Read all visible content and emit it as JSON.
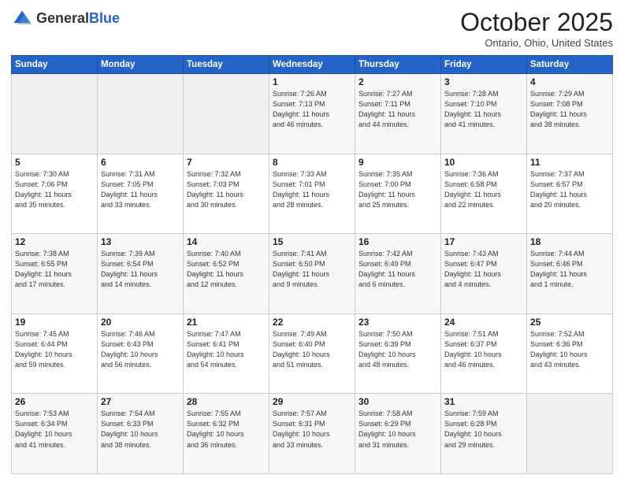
{
  "header": {
    "logo_general": "General",
    "logo_blue": "Blue",
    "month_title": "October 2025",
    "location": "Ontario, Ohio, United States"
  },
  "weekdays": [
    "Sunday",
    "Monday",
    "Tuesday",
    "Wednesday",
    "Thursday",
    "Friday",
    "Saturday"
  ],
  "weeks": [
    [
      {
        "day": "",
        "info": ""
      },
      {
        "day": "",
        "info": ""
      },
      {
        "day": "",
        "info": ""
      },
      {
        "day": "1",
        "info": "Sunrise: 7:26 AM\nSunset: 7:13 PM\nDaylight: 11 hours\nand 46 minutes."
      },
      {
        "day": "2",
        "info": "Sunrise: 7:27 AM\nSunset: 7:11 PM\nDaylight: 11 hours\nand 44 minutes."
      },
      {
        "day": "3",
        "info": "Sunrise: 7:28 AM\nSunset: 7:10 PM\nDaylight: 11 hours\nand 41 minutes."
      },
      {
        "day": "4",
        "info": "Sunrise: 7:29 AM\nSunset: 7:08 PM\nDaylight: 11 hours\nand 38 minutes."
      }
    ],
    [
      {
        "day": "5",
        "info": "Sunrise: 7:30 AM\nSunset: 7:06 PM\nDaylight: 11 hours\nand 35 minutes."
      },
      {
        "day": "6",
        "info": "Sunrise: 7:31 AM\nSunset: 7:05 PM\nDaylight: 11 hours\nand 33 minutes."
      },
      {
        "day": "7",
        "info": "Sunrise: 7:32 AM\nSunset: 7:03 PM\nDaylight: 11 hours\nand 30 minutes."
      },
      {
        "day": "8",
        "info": "Sunrise: 7:33 AM\nSunset: 7:01 PM\nDaylight: 11 hours\nand 28 minutes."
      },
      {
        "day": "9",
        "info": "Sunrise: 7:35 AM\nSunset: 7:00 PM\nDaylight: 11 hours\nand 25 minutes."
      },
      {
        "day": "10",
        "info": "Sunrise: 7:36 AM\nSunset: 6:58 PM\nDaylight: 11 hours\nand 22 minutes."
      },
      {
        "day": "11",
        "info": "Sunrise: 7:37 AM\nSunset: 6:57 PM\nDaylight: 11 hours\nand 20 minutes."
      }
    ],
    [
      {
        "day": "12",
        "info": "Sunrise: 7:38 AM\nSunset: 6:55 PM\nDaylight: 11 hours\nand 17 minutes."
      },
      {
        "day": "13",
        "info": "Sunrise: 7:39 AM\nSunset: 6:54 PM\nDaylight: 11 hours\nand 14 minutes."
      },
      {
        "day": "14",
        "info": "Sunrise: 7:40 AM\nSunset: 6:52 PM\nDaylight: 11 hours\nand 12 minutes."
      },
      {
        "day": "15",
        "info": "Sunrise: 7:41 AM\nSunset: 6:50 PM\nDaylight: 11 hours\nand 9 minutes."
      },
      {
        "day": "16",
        "info": "Sunrise: 7:42 AM\nSunset: 6:49 PM\nDaylight: 11 hours\nand 6 minutes."
      },
      {
        "day": "17",
        "info": "Sunrise: 7:43 AM\nSunset: 6:47 PM\nDaylight: 11 hours\nand 4 minutes."
      },
      {
        "day": "18",
        "info": "Sunrise: 7:44 AM\nSunset: 6:46 PM\nDaylight: 11 hours\nand 1 minute."
      }
    ],
    [
      {
        "day": "19",
        "info": "Sunrise: 7:45 AM\nSunset: 6:44 PM\nDaylight: 10 hours\nand 59 minutes."
      },
      {
        "day": "20",
        "info": "Sunrise: 7:46 AM\nSunset: 6:43 PM\nDaylight: 10 hours\nand 56 minutes."
      },
      {
        "day": "21",
        "info": "Sunrise: 7:47 AM\nSunset: 6:41 PM\nDaylight: 10 hours\nand 54 minutes."
      },
      {
        "day": "22",
        "info": "Sunrise: 7:49 AM\nSunset: 6:40 PM\nDaylight: 10 hours\nand 51 minutes."
      },
      {
        "day": "23",
        "info": "Sunrise: 7:50 AM\nSunset: 6:39 PM\nDaylight: 10 hours\nand 48 minutes."
      },
      {
        "day": "24",
        "info": "Sunrise: 7:51 AM\nSunset: 6:37 PM\nDaylight: 10 hours\nand 46 minutes."
      },
      {
        "day": "25",
        "info": "Sunrise: 7:52 AM\nSunset: 6:36 PM\nDaylight: 10 hours\nand 43 minutes."
      }
    ],
    [
      {
        "day": "26",
        "info": "Sunrise: 7:53 AM\nSunset: 6:34 PM\nDaylight: 10 hours\nand 41 minutes."
      },
      {
        "day": "27",
        "info": "Sunrise: 7:54 AM\nSunset: 6:33 PM\nDaylight: 10 hours\nand 38 minutes."
      },
      {
        "day": "28",
        "info": "Sunrise: 7:55 AM\nSunset: 6:32 PM\nDaylight: 10 hours\nand 36 minutes."
      },
      {
        "day": "29",
        "info": "Sunrise: 7:57 AM\nSunset: 6:31 PM\nDaylight: 10 hours\nand 33 minutes."
      },
      {
        "day": "30",
        "info": "Sunrise: 7:58 AM\nSunset: 6:29 PM\nDaylight: 10 hours\nand 31 minutes."
      },
      {
        "day": "31",
        "info": "Sunrise: 7:59 AM\nSunset: 6:28 PM\nDaylight: 10 hours\nand 29 minutes."
      },
      {
        "day": "",
        "info": ""
      }
    ]
  ]
}
